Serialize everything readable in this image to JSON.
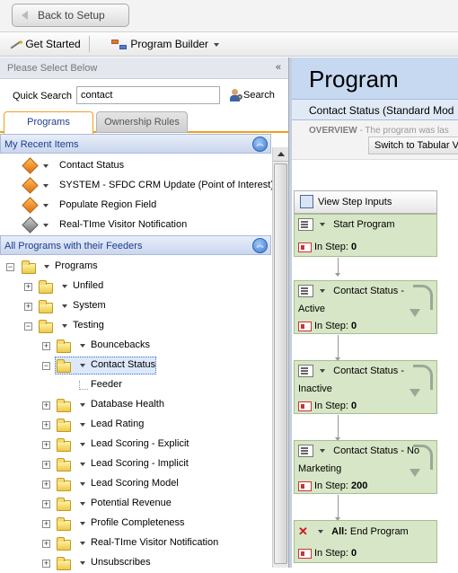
{
  "top": {
    "back_label": "Back to Setup"
  },
  "toolbar": {
    "get_started": "Get Started",
    "program_builder": "Program Builder"
  },
  "left": {
    "select_below": "Please Select Below",
    "collapse_glyph": "«",
    "quick_search_label": "Quick Search",
    "quick_search_value": "contact",
    "search_button": "Search",
    "tabs": [
      "Programs",
      "Ownership Rules"
    ],
    "recent_header": "My Recent Items",
    "recent_items": [
      {
        "label": "Contact Status",
        "icon": "orange-diamond-icon"
      },
      {
        "label": "SYSTEM - SFDC CRM Update (Point of Interest)",
        "icon": "orange-diamond-down-icon"
      },
      {
        "label": "Populate Region Field",
        "icon": "orange-diamond-icon"
      },
      {
        "label": "Real-TIme Visitor Notification",
        "icon": "gray-diamond-icon"
      }
    ],
    "all_header": "All Programs with their Feeders",
    "tree": {
      "root": "Programs",
      "unfiled": "Unfiled",
      "system": "System",
      "testing": "Testing",
      "testing_children": [
        "Bouncebacks",
        "Contact Status",
        "Feeder",
        "Database Health",
        "Lead Rating",
        "Lead Scoring - Explicit",
        "Lead Scoring - Implicit",
        "Lead Scoring Model",
        "Potential Revenue",
        "Profile Completeness",
        "Real-TIme Visitor Notification",
        "Unsubscribes"
      ]
    }
  },
  "right": {
    "title": "Program",
    "subtitle": "Contact Status (Standard Mod",
    "overview_label": "OVERVIEW",
    "overview_text": " - The program was las",
    "switch_button": "Switch to Tabular V",
    "view_step_inputs": "View Step Inputs",
    "in_step_label": "In Step:",
    "steps": [
      {
        "line1": "Start Program",
        "line2": "",
        "count": "0"
      },
      {
        "line1": "Contact Status -",
        "line2": "Active",
        "count": "0"
      },
      {
        "line1": "Contact Status -",
        "line2": "Inactive",
        "count": "0"
      },
      {
        "line1": "Contact Status - No",
        "line2": "Marketing",
        "count": "200"
      },
      {
        "line1": "All:",
        "line1b": " End Program",
        "line2": "",
        "count": "0"
      }
    ]
  }
}
